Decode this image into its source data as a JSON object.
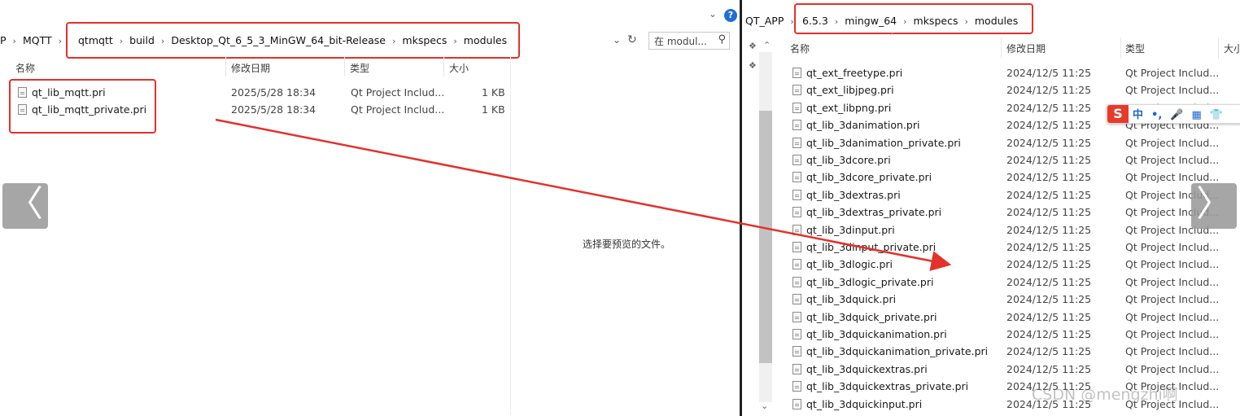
{
  "left_window": {
    "breadcrumb_prefix": [
      "P",
      "MQTT"
    ],
    "breadcrumb_highlighted": [
      "qtmqtt",
      "build",
      "Desktop_Qt_6_5_3_MinGW_64_bit-Release",
      "mkspecs",
      "modules"
    ],
    "search_placeholder": "在 modul...",
    "columns": {
      "name": "名称",
      "date": "修改日期",
      "type": "类型",
      "size": "大小"
    },
    "files": [
      {
        "name": "qt_lib_mqtt.pri",
        "date": "2025/5/28 18:34",
        "type": "Qt Project Includ...",
        "size": "1 KB"
      },
      {
        "name": "qt_lib_mqtt_private.pri",
        "date": "2025/5/28 18:34",
        "type": "Qt Project Includ...",
        "size": "1 KB"
      }
    ],
    "preview_message": "选择要预览的文件。",
    "help_icon": "?"
  },
  "right_window": {
    "breadcrumb_prefix": [
      "QT_APP"
    ],
    "breadcrumb_highlighted": [
      "6.5.3",
      "mingw_64",
      "mkspecs",
      "modules"
    ],
    "columns": {
      "name": "名称",
      "date": "修改日期",
      "type": "类型",
      "size": "大小"
    },
    "files": [
      {
        "name": "qt_ext_freetype.pri",
        "date": "2024/12/5 11:25",
        "type": "Qt Project Includ..."
      },
      {
        "name": "qt_ext_libjpeg.pri",
        "date": "2024/12/5 11:25",
        "type": "Qt Project Includ..."
      },
      {
        "name": "qt_ext_libpng.pri",
        "date": "2024/12/5 11:25",
        "type": "Qt Project Includ..."
      },
      {
        "name": "qt_lib_3danimation.pri",
        "date": "2024/12/5 11:25",
        "type": "Qt Project Includ..."
      },
      {
        "name": "qt_lib_3danimation_private.pri",
        "date": "2024/12/5 11:25",
        "type": "Qt Project Includ..."
      },
      {
        "name": "qt_lib_3dcore.pri",
        "date": "2024/12/5 11:25",
        "type": "Qt Project Includ..."
      },
      {
        "name": "qt_lib_3dcore_private.pri",
        "date": "2024/12/5 11:25",
        "type": "Qt Project Includ..."
      },
      {
        "name": "qt_lib_3dextras.pri",
        "date": "2024/12/5 11:25",
        "type": "Qt Project Includ..."
      },
      {
        "name": "qt_lib_3dextras_private.pri",
        "date": "2024/12/5 11:25",
        "type": "Qt Project Includ..."
      },
      {
        "name": "qt_lib_3dinput.pri",
        "date": "2024/12/5 11:25",
        "type": "Qt Project Includ..."
      },
      {
        "name": "qt_lib_3dinput_private.pri",
        "date": "2024/12/5 11:25",
        "type": "Qt Project Includ..."
      },
      {
        "name": "qt_lib_3dlogic.pri",
        "date": "2024/12/5 11:25",
        "type": "Qt Project Includ..."
      },
      {
        "name": "qt_lib_3dlogic_private.pri",
        "date": "2024/12/5 11:25",
        "type": "Qt Project Includ..."
      },
      {
        "name": "qt_lib_3dquick.pri",
        "date": "2024/12/5 11:25",
        "type": "Qt Project Includ..."
      },
      {
        "name": "qt_lib_3dquick_private.pri",
        "date": "2024/12/5 11:25",
        "type": "Qt Project Includ..."
      },
      {
        "name": "qt_lib_3dquickanimation.pri",
        "date": "2024/12/5 11:25",
        "type": "Qt Project Includ..."
      },
      {
        "name": "qt_lib_3dquickanimation_private.pri",
        "date": "2024/12/5 11:25",
        "type": "Qt Project Includ..."
      },
      {
        "name": "qt_lib_3dquickextras.pri",
        "date": "2024/12/5 11:25",
        "type": "Qt Project Includ..."
      },
      {
        "name": "qt_lib_3dquickextras_private.pri",
        "date": "2024/12/5 11:25",
        "type": "Qt Project Includ..."
      },
      {
        "name": "qt_lib_3dquickinput.pri",
        "date": "2024/12/5 11:25",
        "type": "Qt Project Includ..."
      }
    ]
  },
  "ime_toolbar": {
    "logo": "S",
    "items": [
      "中",
      "•,",
      "🎤",
      "▦",
      "👕",
      "⁝⁝"
    ]
  },
  "overlay": {
    "prev_arrow": "〈",
    "next_arrow": "〉",
    "watermark": "CSDN @mengzhi啊"
  },
  "colors": {
    "highlight_box": "#e4312b",
    "arrow": "#e4312b",
    "help": "#1d6fd6"
  }
}
